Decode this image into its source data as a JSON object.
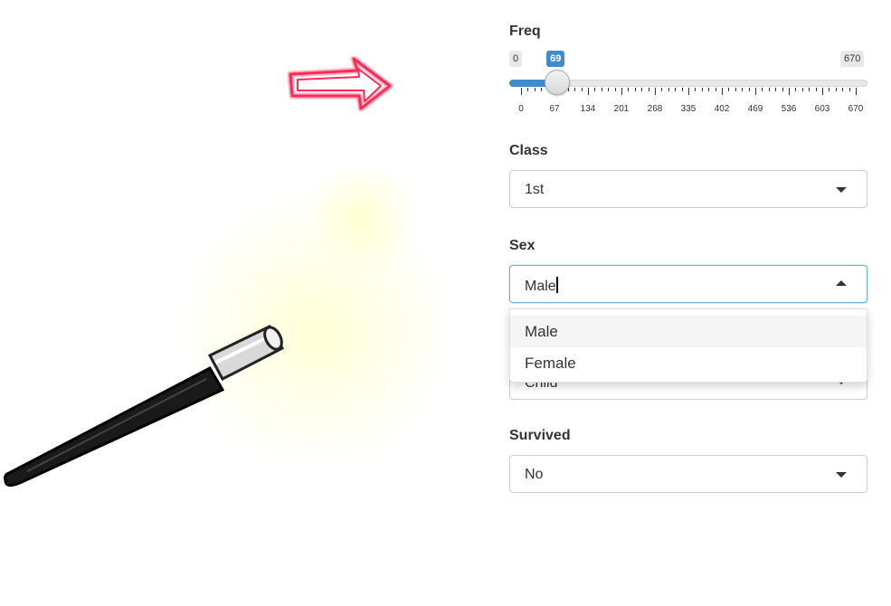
{
  "freq": {
    "label": "Freq",
    "min": 0,
    "max": 670,
    "value": 69,
    "min_label": "0",
    "max_label": "670",
    "value_label": "69",
    "ticks": [
      "0",
      "67",
      "134",
      "201",
      "268",
      "335",
      "402",
      "469",
      "536",
      "603",
      "670"
    ]
  },
  "class": {
    "label": "Class",
    "value": "1st"
  },
  "sex": {
    "label": "Sex",
    "value": "Male",
    "options": [
      "Male",
      "Female"
    ],
    "highlighted": "Male"
  },
  "age": {
    "partial_value": "Child"
  },
  "survived": {
    "label": "Survived",
    "value": "No"
  },
  "icons": {
    "arrow": "red-outline-arrow-icon",
    "wand": "magic-wand-icon"
  },
  "colors": {
    "accent": "#428bca",
    "arrow": "#ff2a55",
    "focus": "#66afe9"
  }
}
